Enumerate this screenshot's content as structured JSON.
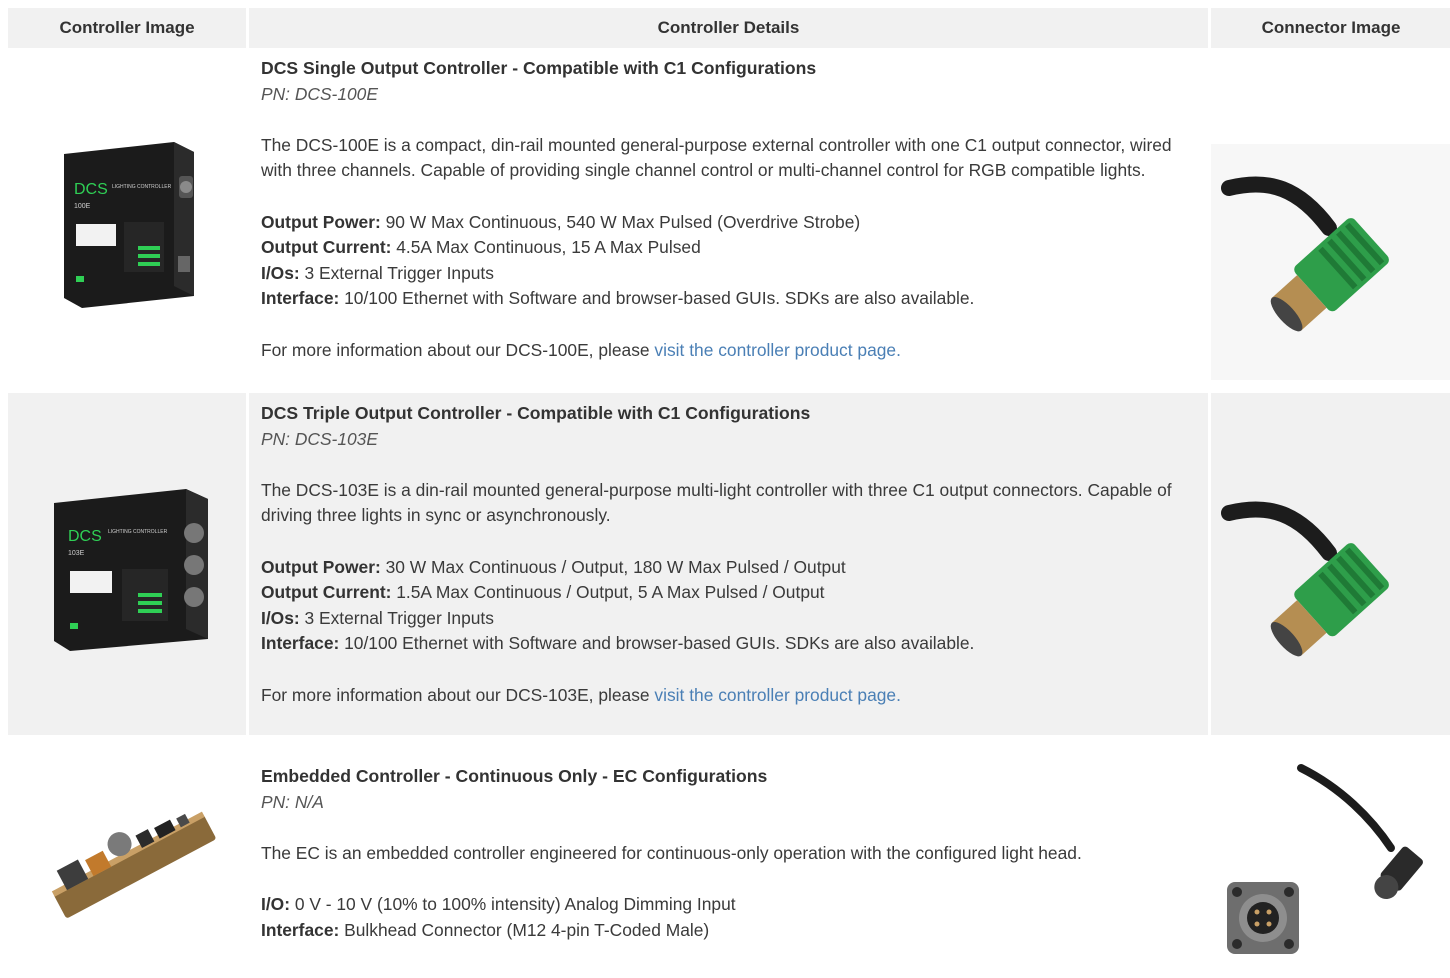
{
  "headers": {
    "col1": "Controller Image",
    "col2": "Controller Details",
    "col3": "Connector Image"
  },
  "rows": [
    {
      "title": "DCS Single Output Controller - Compatible with C1 Configurations",
      "pn": "PN: DCS-100E",
      "description": "The DCS-100E is a compact, din-rail mounted general-purpose external controller with one C1 output connector, wired with three channels. Capable of providing single channel control or multi-channel control for RGB compatible lights.",
      "specs": [
        {
          "label": "Output Power:",
          "value": " 90 W Max Continuous, 540 W Max Pulsed (Overdrive Strobe)"
        },
        {
          "label": "Output Current:",
          "value": " 4.5A Max Continuous, 15 A Max Pulsed"
        },
        {
          "label": "I/Os:",
          "value": " 3 External Trigger Inputs"
        },
        {
          "label": "Interface:",
          "value": " 10/100 Ethernet with Software and browser-based GUIs. SDKs are also available."
        }
      ],
      "more_prefix": "For more information about our DCS-100E, please ",
      "more_link": "visit the controller product page.",
      "device_brand": "DCS",
      "device_model": "100E",
      "device_product": "LIGHTING CONTROLLER"
    },
    {
      "title": "DCS Triple Output Controller - Compatible with C1 Configurations",
      "pn": "PN: DCS-103E",
      "description": "The DCS-103E is a din-rail mounted general-purpose multi-light controller with three C1 output connectors. Capable of driving three lights in sync or asynchronously.",
      "specs": [
        {
          "label": "Output Power:",
          "value": " 30 W Max Continuous / Output, 180 W Max Pulsed / Output"
        },
        {
          "label": "Output Current:",
          "value": " 1.5A Max Continuous / Output, 5 A Max Pulsed / Output"
        },
        {
          "label": "I/Os:",
          "value": " 3 External Trigger Inputs"
        },
        {
          "label": "Interface:",
          "value": " 10/100 Ethernet with Software and browser-based GUIs. SDKs are also available."
        }
      ],
      "more_prefix": "For more information about our DCS-103E, please ",
      "more_link": "visit the controller product page.",
      "device_brand": "DCS",
      "device_model": "103E",
      "device_product": "LIGHTING CONTROLLER"
    },
    {
      "title": "Embedded Controller - Continuous Only - EC Configurations",
      "pn": "PN: N/A",
      "description": "The EC is an embedded controller engineered for continuous-only operation with the configured light head.",
      "specs": [
        {
          "label": "I/O:",
          "value": " 0 V - 10 V (10% to 100% intensity) Analog Dimming Input"
        },
        {
          "label": "Interface:",
          "value": " Bulkhead Connector (M12 4-pin T-Coded Male)"
        }
      ]
    }
  ],
  "colors": {
    "header_bg": "#f1f1f1",
    "alt_row_bg": "#f1f1f1",
    "link": "#4a7fb5",
    "connector_green": "#2e9e4a",
    "device_green": "#2fcf55"
  },
  "icons": [
    "controller-device-image",
    "m12-connector-image",
    "embedded-pcb-image",
    "female-connector-image"
  ]
}
